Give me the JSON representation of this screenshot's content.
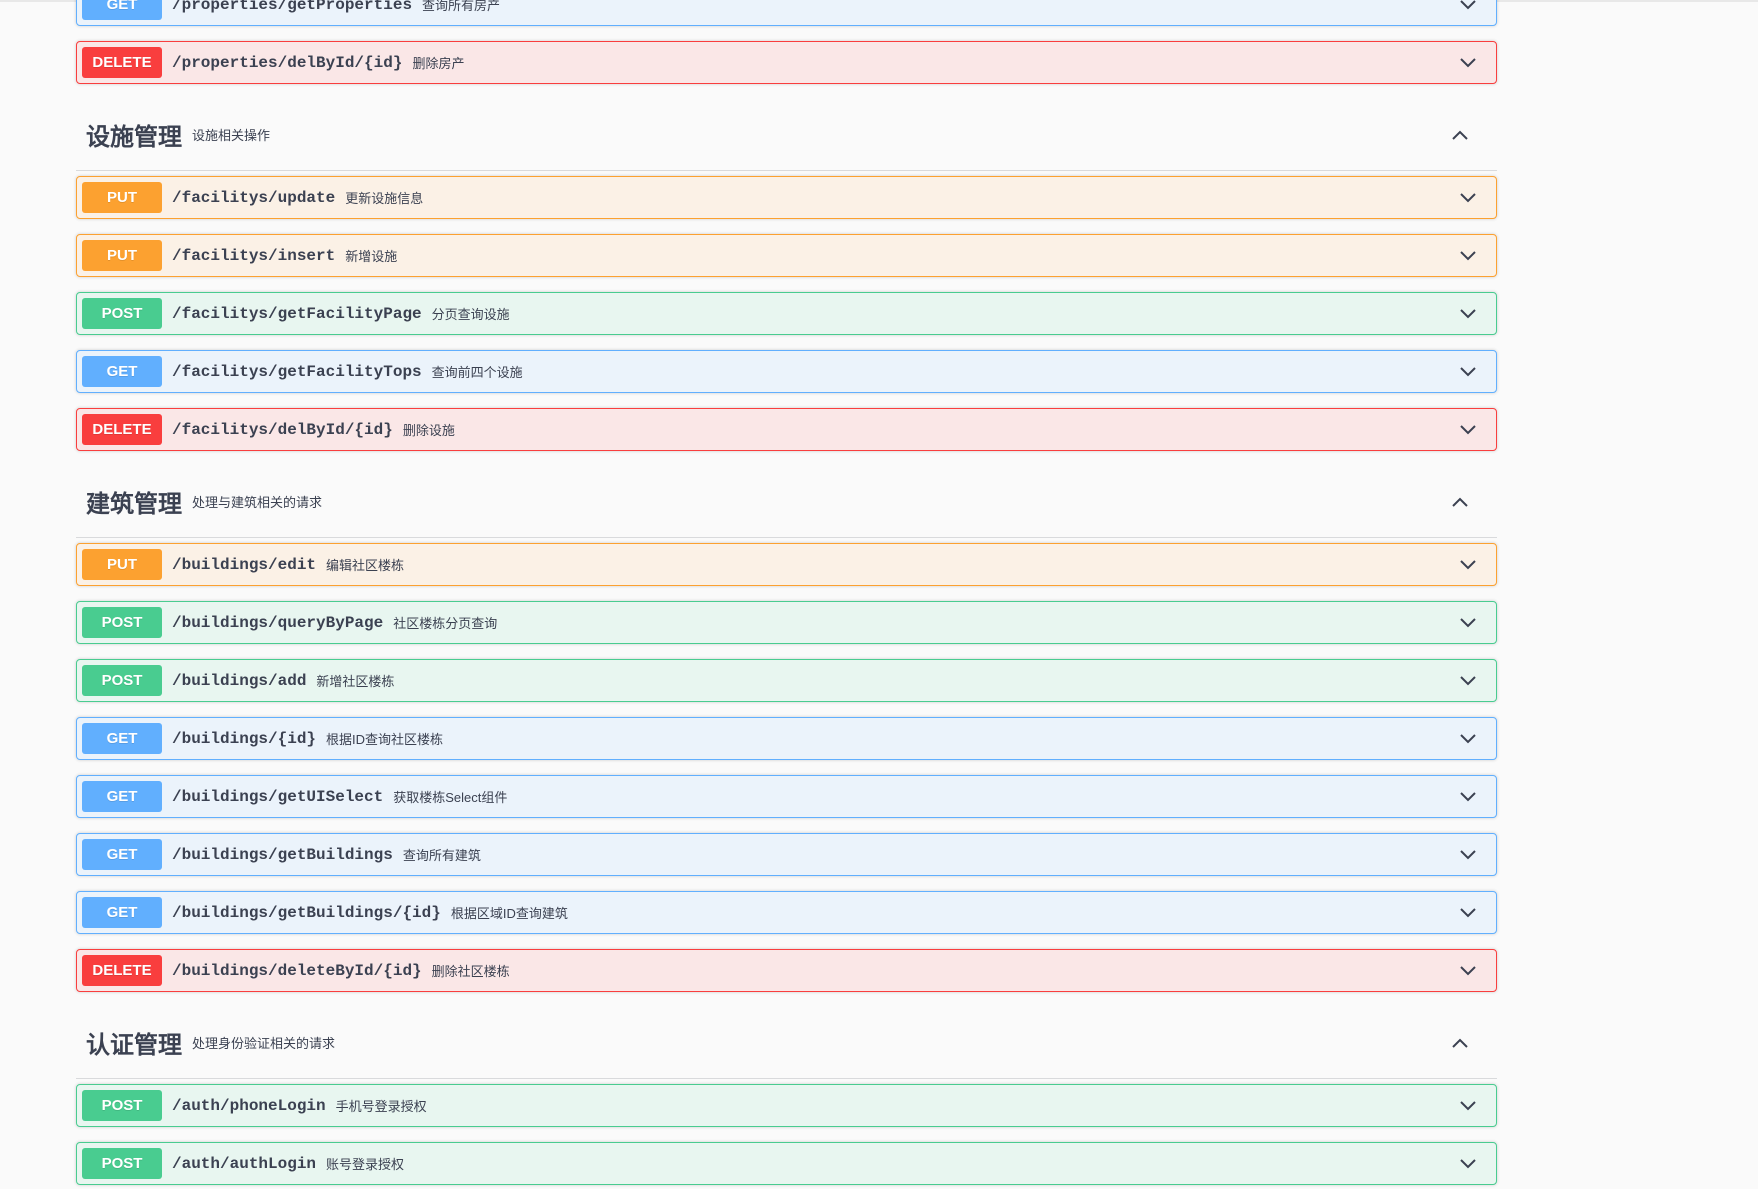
{
  "colors": {
    "get": "#61affe",
    "post": "#49cc90",
    "put": "#fca130",
    "delete": "#f93e3e",
    "text": "#3b4151"
  },
  "partial_ops": [
    {
      "method": "GET",
      "path": "/properties/getProperties",
      "summary": "查询所有房产"
    },
    {
      "method": "DELETE",
      "path": "/properties/delById/{id}",
      "summary": "删除房产"
    }
  ],
  "sections": [
    {
      "title": "设施管理",
      "description": "设施相关操作",
      "ops": [
        {
          "method": "PUT",
          "path": "/facilitys/update",
          "summary": "更新设施信息"
        },
        {
          "method": "PUT",
          "path": "/facilitys/insert",
          "summary": "新增设施"
        },
        {
          "method": "POST",
          "path": "/facilitys/getFacilityPage",
          "summary": "分页查询设施"
        },
        {
          "method": "GET",
          "path": "/facilitys/getFacilityTops",
          "summary": "查询前四个设施"
        },
        {
          "method": "DELETE",
          "path": "/facilitys/delById/{id}",
          "summary": "删除设施"
        }
      ]
    },
    {
      "title": "建筑管理",
      "description": "处理与建筑相关的请求",
      "ops": [
        {
          "method": "PUT",
          "path": "/buildings/edit",
          "summary": "编辑社区楼栋"
        },
        {
          "method": "POST",
          "path": "/buildings/queryByPage",
          "summary": "社区楼栋分页查询"
        },
        {
          "method": "POST",
          "path": "/buildings/add",
          "summary": "新增社区楼栋"
        },
        {
          "method": "GET",
          "path": "/buildings/{id}",
          "summary": "根据ID查询社区楼栋"
        },
        {
          "method": "GET",
          "path": "/buildings/getUISelect",
          "summary": "获取楼栋Select组件"
        },
        {
          "method": "GET",
          "path": "/buildings/getBuildings",
          "summary": "查询所有建筑"
        },
        {
          "method": "GET",
          "path": "/buildings/getBuildings/{id}",
          "summary": "根据区域ID查询建筑"
        },
        {
          "method": "DELETE",
          "path": "/buildings/deleteById/{id}",
          "summary": "删除社区楼栋"
        }
      ]
    },
    {
      "title": "认证管理",
      "description": "处理身份验证相关的请求",
      "ops": [
        {
          "method": "POST",
          "path": "/auth/phoneLogin",
          "summary": "手机号登录授权"
        },
        {
          "method": "POST",
          "path": "/auth/authLogin",
          "summary": "账号登录授权"
        }
      ]
    }
  ]
}
